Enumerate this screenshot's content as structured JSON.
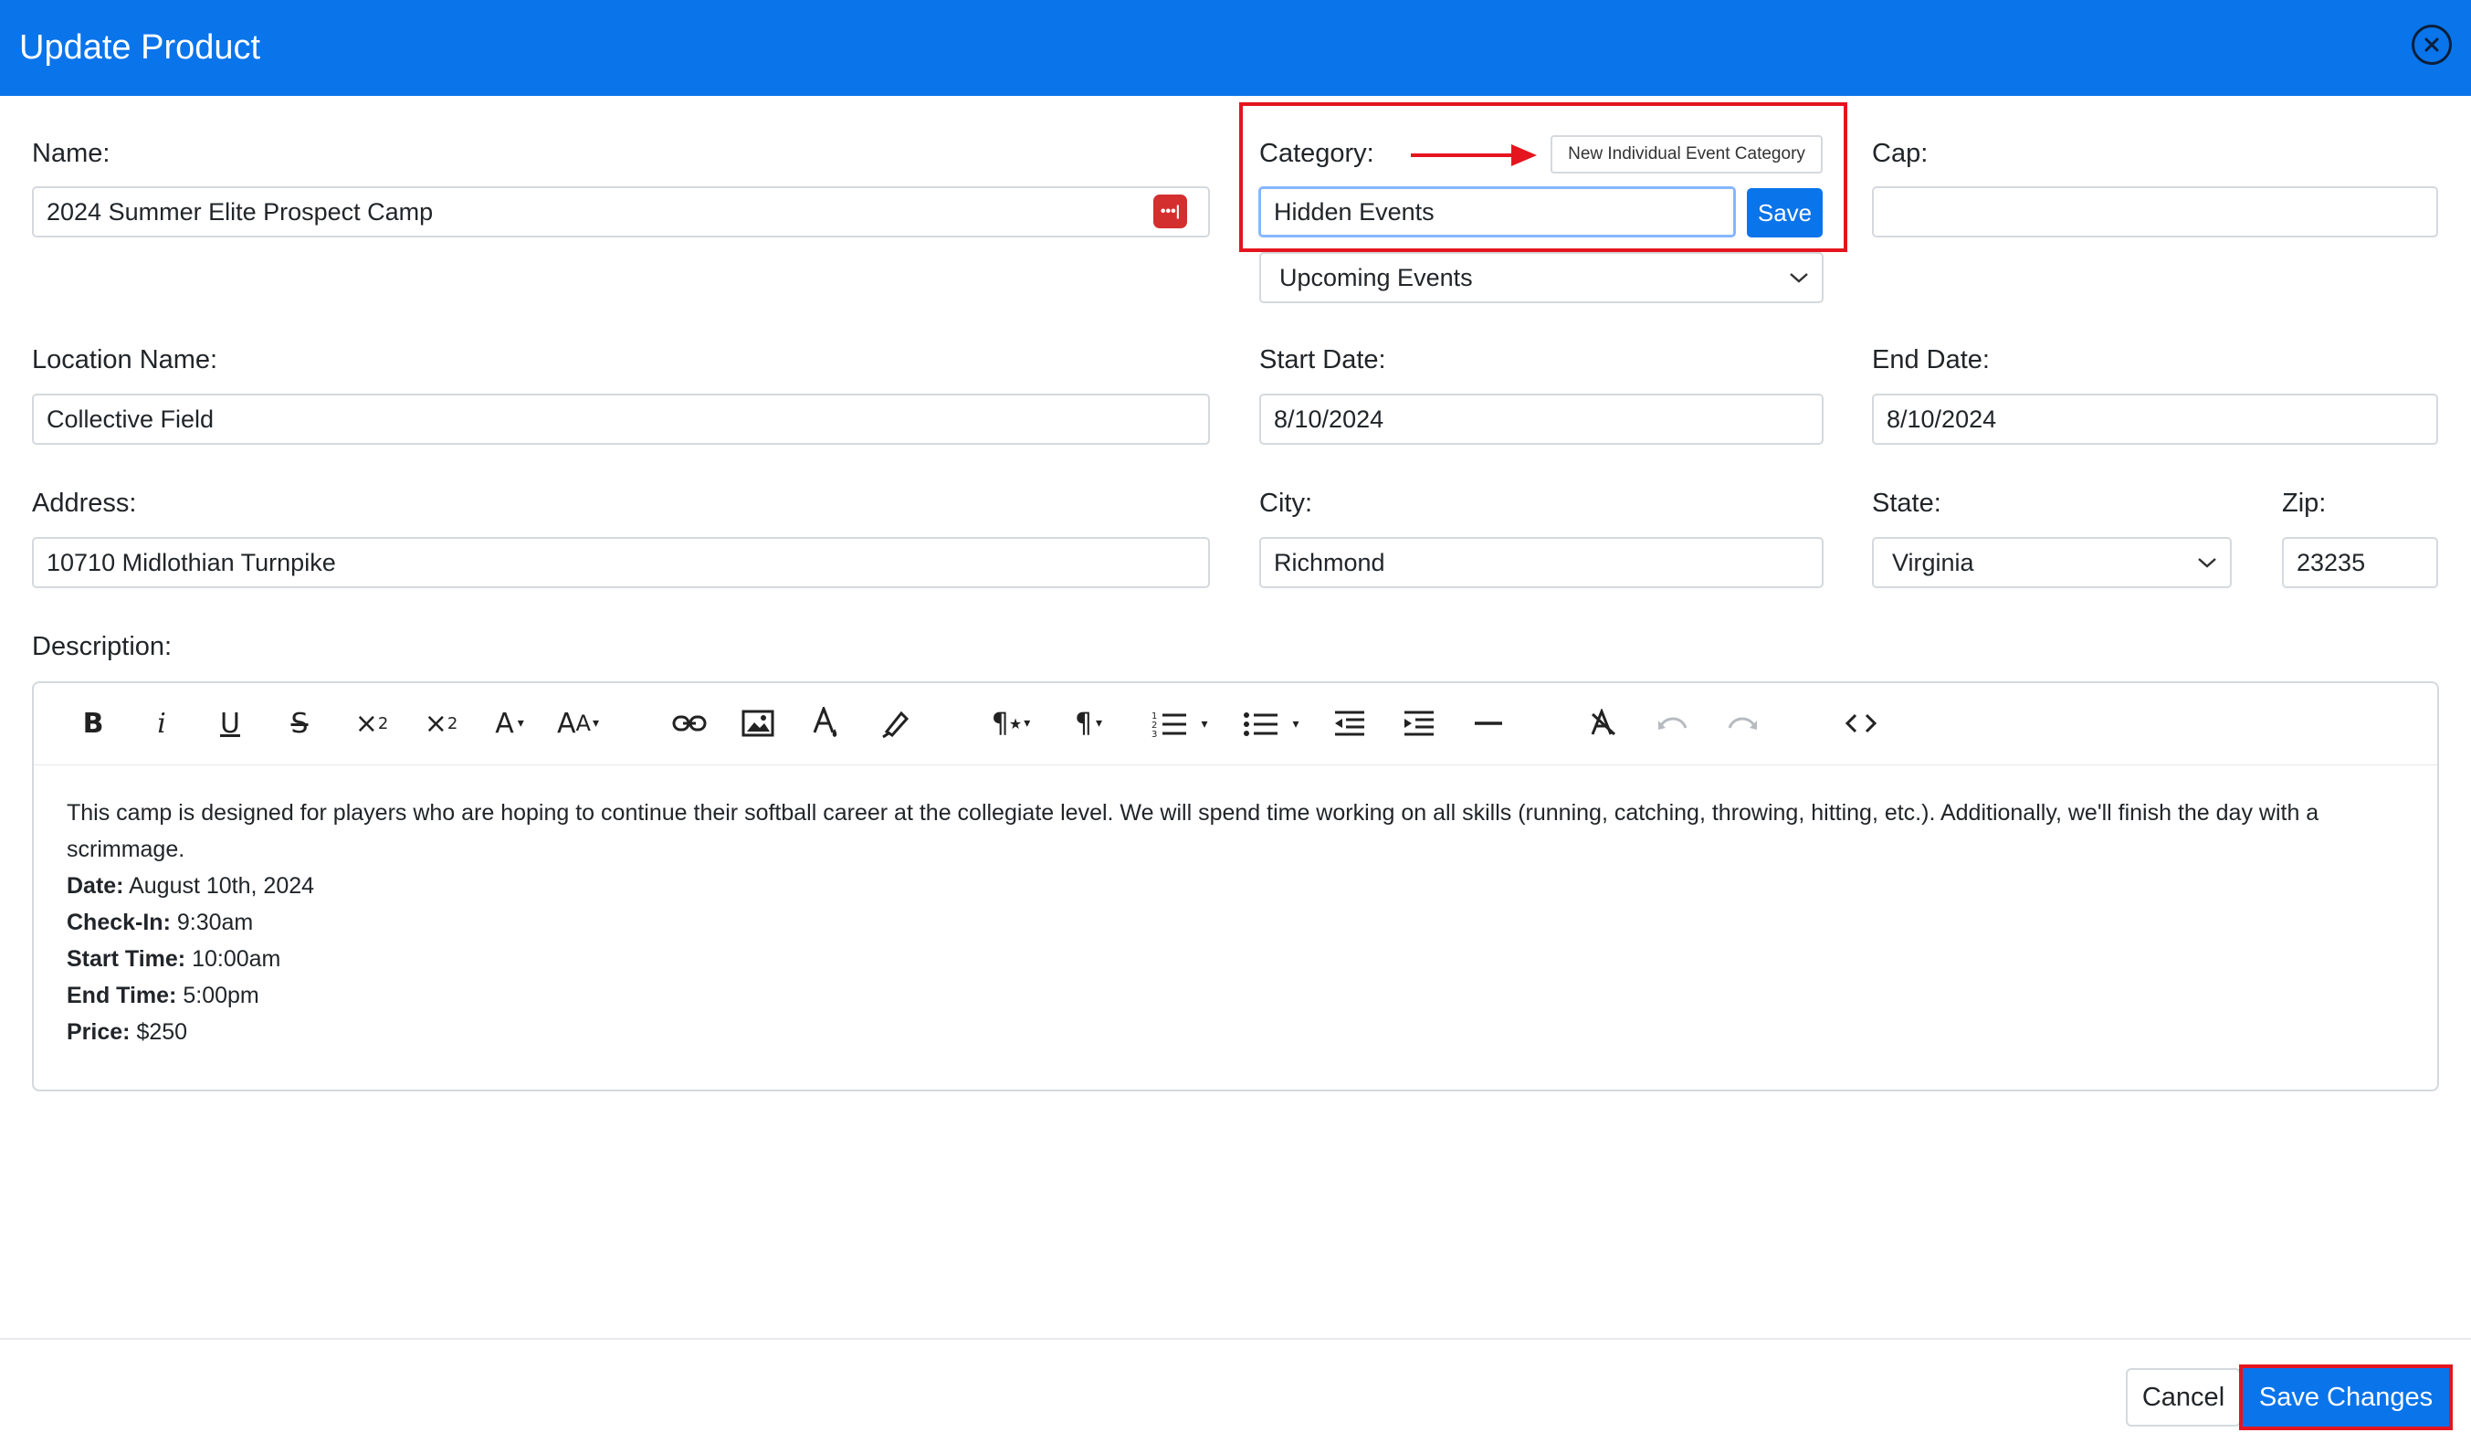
{
  "dialog": {
    "title": "Update Product"
  },
  "fields": {
    "name": {
      "label": "Name:",
      "value": "2024 Summer Elite Prospect Camp"
    },
    "category": {
      "label": "Category:",
      "new_button": "New Individual Event Category",
      "new_value": "Hidden Events",
      "save_label": "Save",
      "selected": "Upcoming Events"
    },
    "cap": {
      "label": "Cap:",
      "value": ""
    },
    "location_name": {
      "label": "Location Name:",
      "value": "Collective Field"
    },
    "start_date": {
      "label": "Start Date:",
      "value": "8/10/2024"
    },
    "end_date": {
      "label": "End Date:",
      "value": "8/10/2024"
    },
    "address": {
      "label": "Address:",
      "value": "10710 Midlothian Turnpike"
    },
    "city": {
      "label": "City:",
      "value": "Richmond"
    },
    "state": {
      "label": "State:",
      "value": "Virginia"
    },
    "zip": {
      "label": "Zip:",
      "value": "23235"
    }
  },
  "description": {
    "label": "Description:",
    "intro": "This camp is designed for players who are hoping to continue their softball career at the collegiate level.  We will spend time working on all skills (running, catching, throwing, hitting, etc.).  Additionally, we'll finish the day with a scrimmage.",
    "lines": [
      {
        "key": "Date:",
        "value": "August 10th, 2024"
      },
      {
        "key": "Check-In:",
        "value": "9:30am"
      },
      {
        "key": "Start Time:",
        "value": "10:00am"
      },
      {
        "key": "End Time:",
        "value": "5:00pm"
      },
      {
        "key": "Price:",
        "value": "$250"
      }
    ],
    "toolbar": [
      "bold-icon",
      "italic-icon",
      "underline-icon",
      "strikethrough-icon",
      "subscript-icon",
      "superscript-icon",
      "font-color-dropdown",
      "font-size-dropdown",
      "link-icon",
      "image-icon",
      "text-color-icon",
      "highlight-icon",
      "paragraph-style-dropdown",
      "paragraph-format-dropdown",
      "ordered-list-dropdown",
      "unordered-list-dropdown",
      "outdent-icon",
      "indent-icon",
      "horizontal-line-icon",
      "clear-format-icon",
      "undo-icon",
      "redo-icon",
      "code-view-icon"
    ]
  },
  "footer": {
    "cancel": "Cancel",
    "save": "Save Changes"
  },
  "colors": {
    "primary": "#0a74eb",
    "highlight_frame": "#e4151f"
  }
}
